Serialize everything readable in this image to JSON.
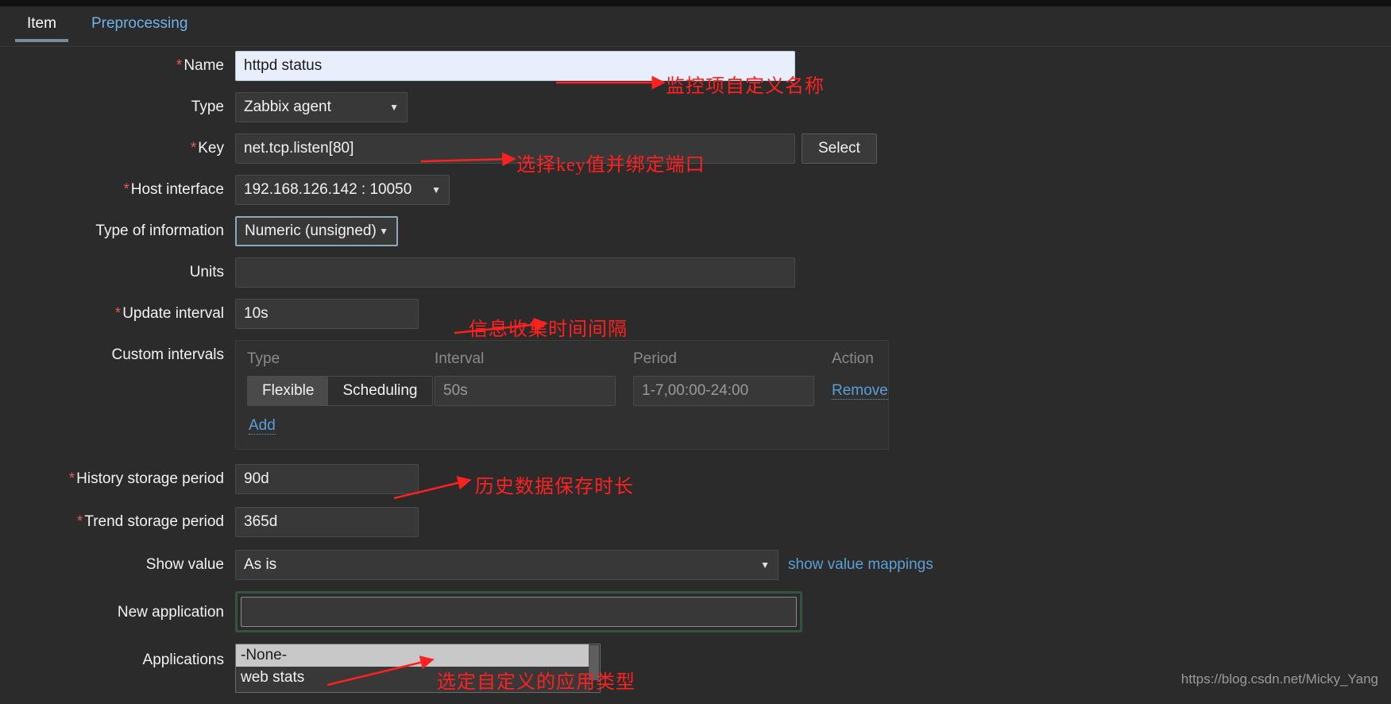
{
  "tabs": [
    {
      "label": "Item",
      "active": true
    },
    {
      "label": "Preprocessing",
      "active": false
    }
  ],
  "form": {
    "name": {
      "label": "Name",
      "required": true,
      "value": "httpd status"
    },
    "type": {
      "label": "Type",
      "required": false,
      "value": "Zabbix agent",
      "options": [
        "Zabbix agent"
      ]
    },
    "key": {
      "label": "Key",
      "required": true,
      "value": "net.tcp.listen[80]",
      "select_button": "Select"
    },
    "host_interface": {
      "label": "Host interface",
      "required": true,
      "value": "192.168.126.142 : 10050",
      "options": [
        "192.168.126.142 : 10050"
      ]
    },
    "type_of_information": {
      "label": "Type of information",
      "required": false,
      "value": "Numeric (unsigned)",
      "options": [
        "Numeric (unsigned)"
      ]
    },
    "units": {
      "label": "Units",
      "required": false,
      "value": ""
    },
    "update_interval": {
      "label": "Update interval",
      "required": true,
      "value": "10s"
    },
    "custom_intervals": {
      "label": "Custom intervals",
      "columns": [
        "Type",
        "Interval",
        "Period",
        "Action"
      ],
      "rows": [
        {
          "type_flexible": "Flexible",
          "type_scheduling": "Scheduling",
          "type_selected": "Flexible",
          "interval": "50s",
          "period": "1-7,00:00-24:00",
          "action": "Remove"
        }
      ],
      "add_label": "Add"
    },
    "history_storage_period": {
      "label": "History storage period",
      "required": true,
      "value": "90d"
    },
    "trend_storage_period": {
      "label": "Trend storage period",
      "required": true,
      "value": "365d"
    },
    "show_value": {
      "label": "Show value",
      "required": false,
      "value": "As is",
      "options": [
        "As is"
      ],
      "link_label": "show value mappings"
    },
    "new_application": {
      "label": "New application",
      "required": false,
      "value": ""
    },
    "applications": {
      "label": "Applications",
      "options": [
        "-None-",
        "web stats"
      ],
      "selected": "-None-"
    }
  },
  "annotations": [
    {
      "id": "name-anno",
      "text": "监控项自定义名称"
    },
    {
      "id": "key-anno",
      "text": "选择key值并绑定端口"
    },
    {
      "id": "interval-anno",
      "text": "信息收集时间间隔"
    },
    {
      "id": "history-anno",
      "text": "历史数据保存时长"
    },
    {
      "id": "apps-anno",
      "text": "选定自定义的应用类型"
    }
  ],
  "watermark": "https://blog.csdn.net/Micky_Yang",
  "colors": {
    "background": "#2b2b2b",
    "accent_link": "#5a9fd6",
    "required_star": "#e45959",
    "annotation_red": "#ff2020",
    "focus_border": "#8ea8b8",
    "highlight_green": "#35543f",
    "name_field_bg": "#e8eefb"
  }
}
